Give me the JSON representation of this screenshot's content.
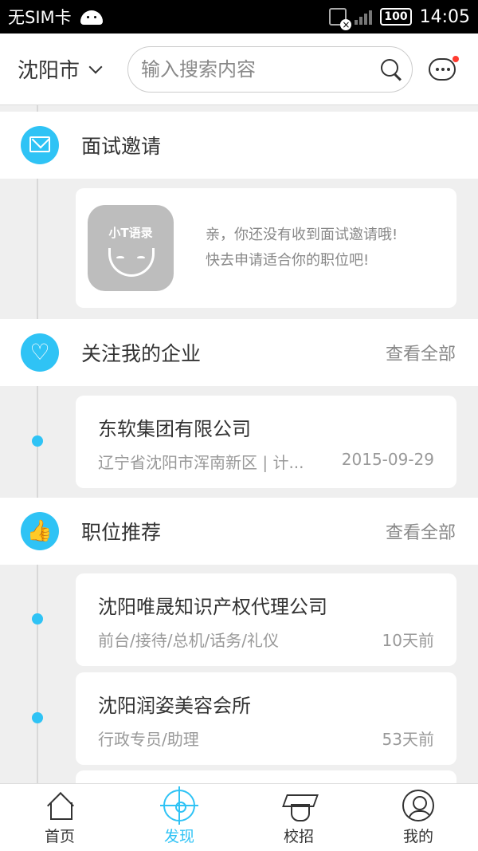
{
  "status_bar": {
    "carrier": "无SIM卡",
    "battery": "100",
    "time": "14:05"
  },
  "header": {
    "city": "沈阳市",
    "search_placeholder": "输入搜索内容"
  },
  "interview": {
    "title": "面试邀请",
    "mascot_label": "小T语录",
    "empty_line1": "亲，你还没有收到面试邀请哦!",
    "empty_line2": "快去申请适合你的职位吧!"
  },
  "followed": {
    "title": "关注我的企业",
    "more": "查看全部",
    "items": [
      {
        "name": "东软集团有限公司",
        "info": "辽宁省沈阳市浑南新区 | 计...",
        "date": "2015-09-29"
      }
    ]
  },
  "recommend": {
    "title": "职位推荐",
    "more": "查看全部",
    "items": [
      {
        "company": "沈阳唯晟知识产权代理公司",
        "position": "前台/接待/总机/话务/礼仪",
        "time": "10天前"
      },
      {
        "company": "沈阳润姿美容会所",
        "position": "行政专员/助理",
        "time": "53天前"
      }
    ]
  },
  "bottom_nav": {
    "items": [
      {
        "label": "首页",
        "icon": "home-icon"
      },
      {
        "label": "发现",
        "icon": "discover-icon"
      },
      {
        "label": "校招",
        "icon": "graduation-cap-icon"
      },
      {
        "label": "我的",
        "icon": "profile-icon"
      }
    ]
  },
  "colors": {
    "accent": "#2fc3f5",
    "background": "#efefef",
    "notification_dot": "#ff3b30"
  }
}
